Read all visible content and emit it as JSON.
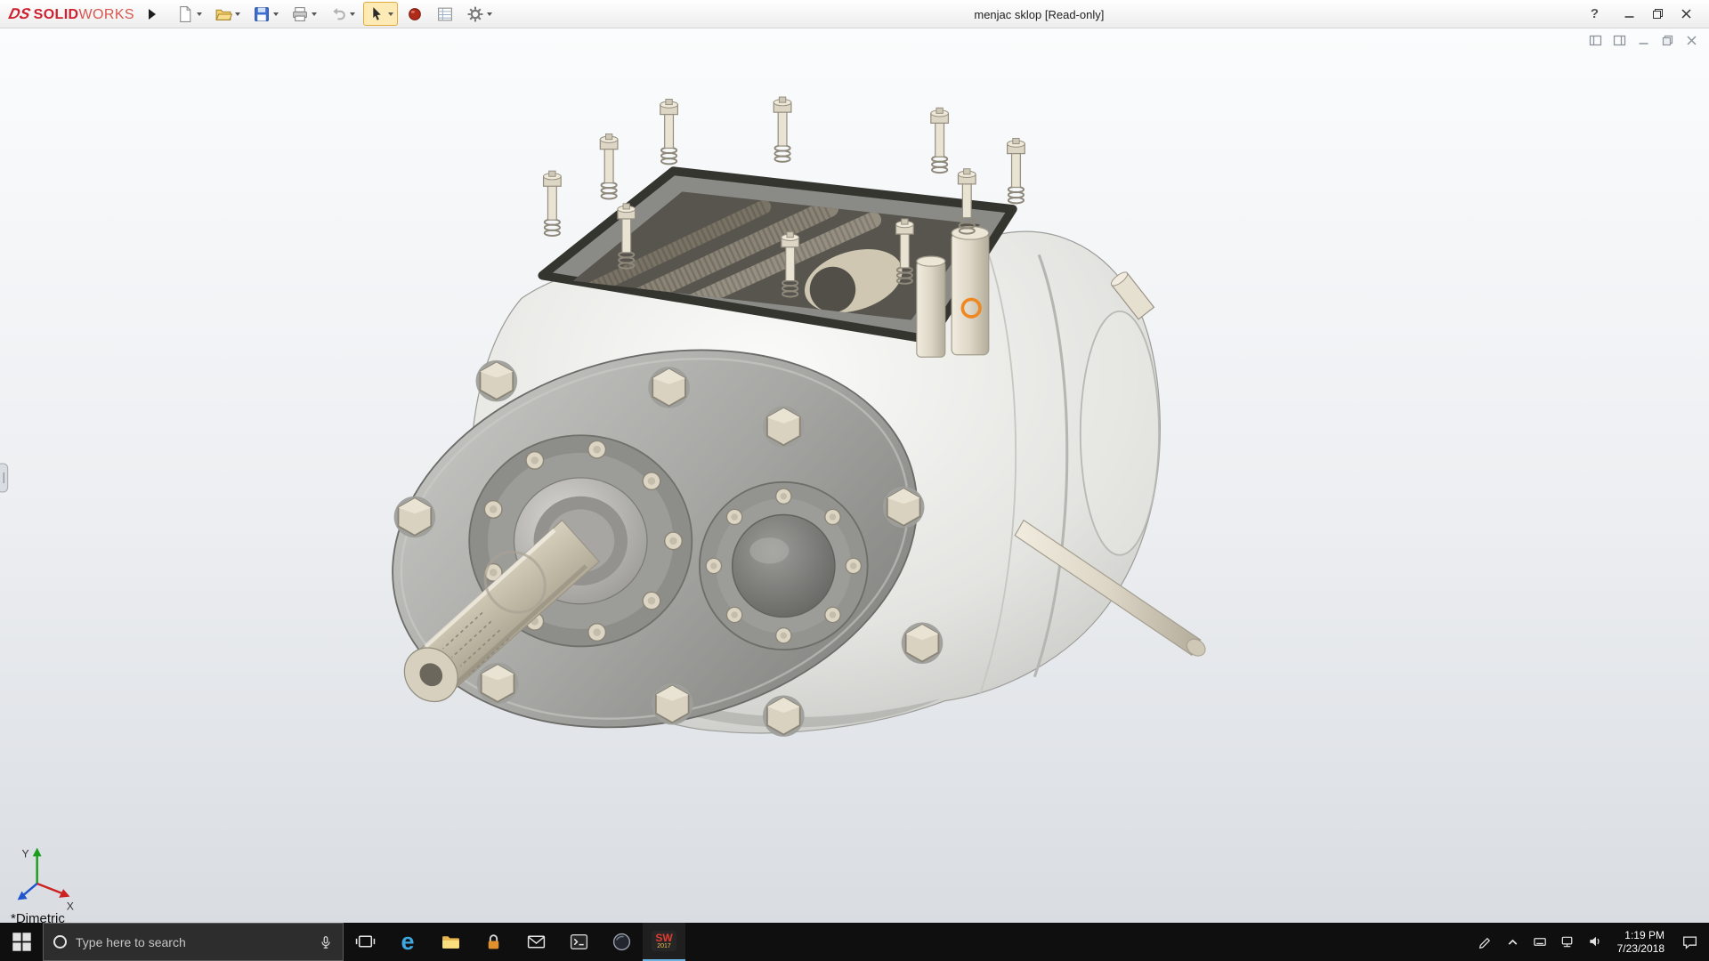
{
  "titlebar": {
    "logo_mark": "DS",
    "logo_solid": "SOLID",
    "logo_works": "WORKS",
    "title": "menjac sklop [Read-only]",
    "help": "?"
  },
  "toolbar": {
    "icons": [
      "new-document",
      "open",
      "save",
      "print",
      "undo",
      "select",
      "appearance",
      "sheet-properties",
      "options"
    ]
  },
  "viewport": {
    "view_label": "*Dimetric",
    "triad": {
      "x_label": "X",
      "y_label": "Y"
    },
    "selection_marker_color": "#ee8822",
    "background_top": "#fbfcfd",
    "background_bottom": "#dadee3"
  },
  "taskbar": {
    "search_placeholder": "Type here to search",
    "edge_glyph": "e",
    "solidworks_icon": {
      "text": "SW",
      "year": "2017"
    },
    "clock": {
      "time": "1:19 PM",
      "date": "7/23/2018"
    }
  }
}
